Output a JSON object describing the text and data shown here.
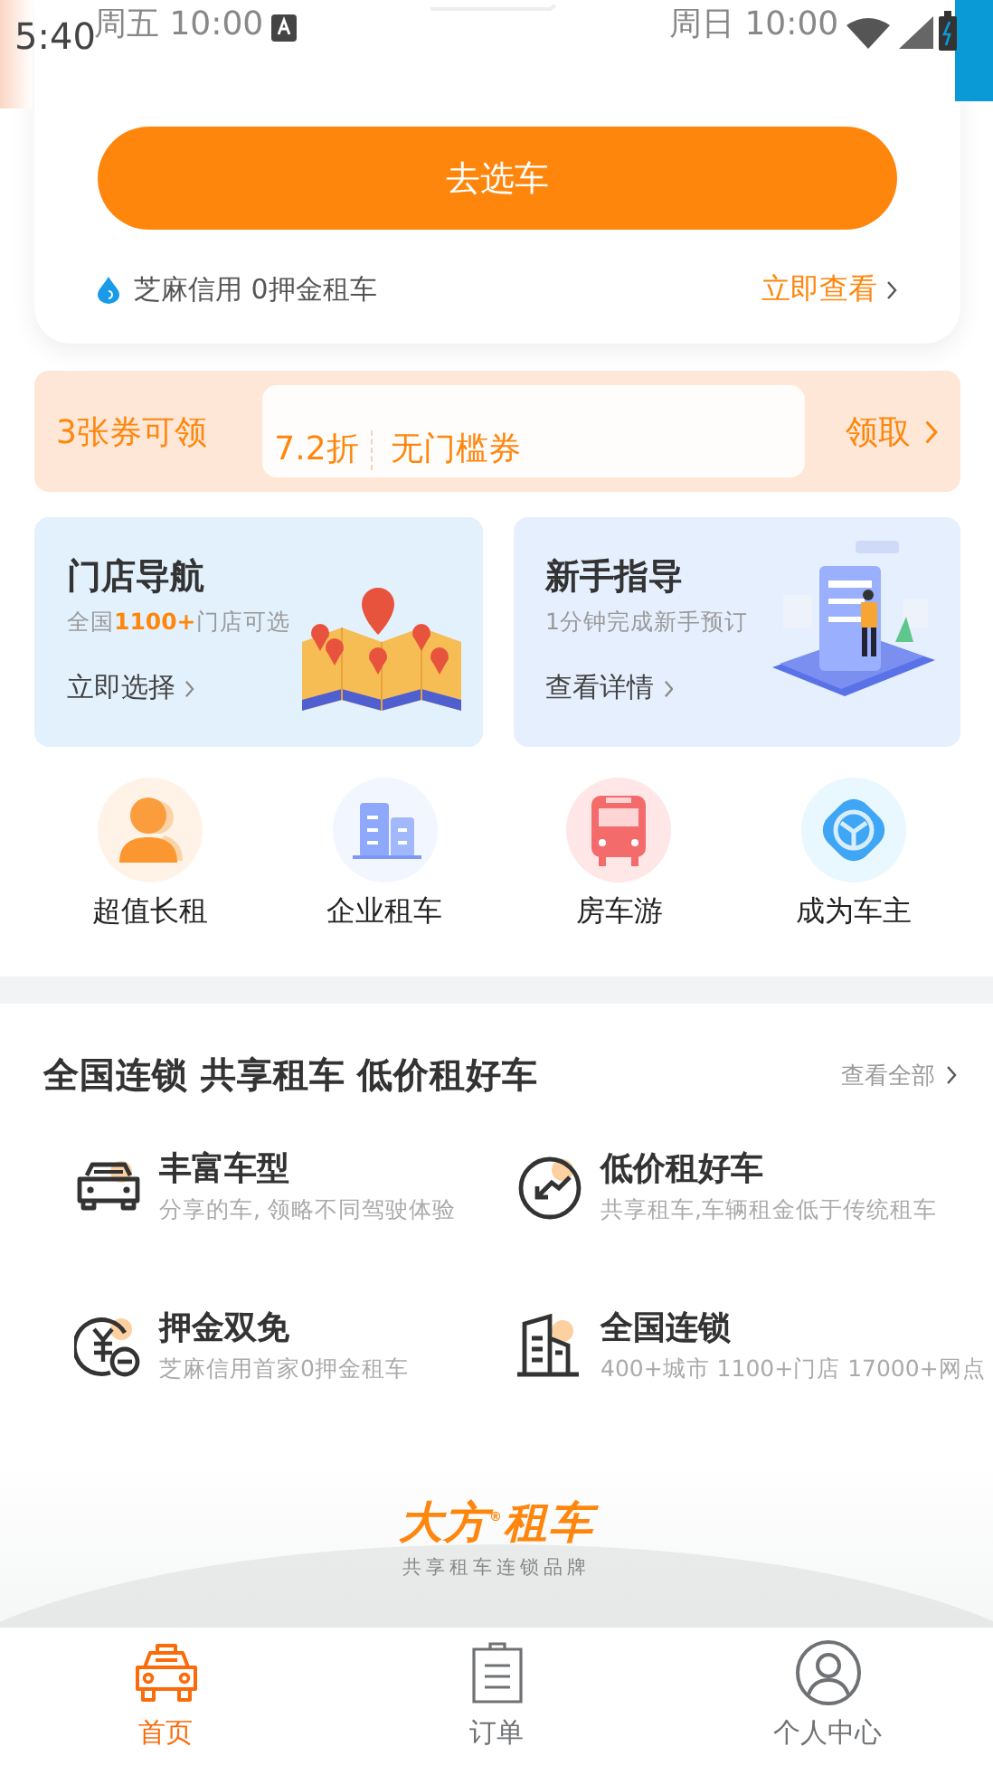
{
  "status_bar": {
    "time": "5:40",
    "overlay_texts": [
      "周五 10:00",
      "周日 10:00"
    ]
  },
  "rent_card": {
    "button": "去选车",
    "credit_text": "芝麻信用 0押金租车",
    "credit_link": "立即查看"
  },
  "coupon": {
    "label": "3张券可领",
    "discount": "7.2折",
    "coupon_name": "无门槛券",
    "action": "领取"
  },
  "promo_cards": [
    {
      "kind": "map",
      "title": "门店导航",
      "subtitle": "全国**1100+**门店可选",
      "link": "立即选择"
    },
    {
      "kind": "guide",
      "title": "新手指导",
      "subtitle": "1分钟完成新手预订",
      "link": "查看详情"
    }
  ],
  "quick_links": [
    {
      "kind": "person",
      "label": "超值长租"
    },
    {
      "kind": "building",
      "label": "企业租车"
    },
    {
      "kind": "bus",
      "label": "房车游"
    },
    {
      "kind": "wheel",
      "label": "成为车主"
    }
  ],
  "features": {
    "title": "全国连锁 共享租车 低价租好车",
    "more": "查看全部",
    "items": [
      {
        "kind": "car",
        "title": "丰富车型",
        "desc": "分享的车, 领略不同驾驶体验"
      },
      {
        "kind": "price",
        "title": "低价租好车",
        "desc": "共享租车,车辆租金低于传统租车"
      },
      {
        "kind": "deposit",
        "title": "押金双免",
        "desc": "芝麻信用首家0押金租车"
      },
      {
        "kind": "chain",
        "title": "全国连锁",
        "desc": "400+城市 1100+门店 17000+网点"
      }
    ]
  },
  "brand": {
    "logo": "大方$^{®}$租车",
    "slogan": "共享租车连锁品牌"
  },
  "tabs": [
    {
      "kind": "home",
      "label": "首页",
      "selected": true
    },
    {
      "kind": "orders",
      "label": "订单",
      "selected": false
    },
    {
      "kind": "profile",
      "label": "个人中心",
      "selected": false
    }
  ]
}
